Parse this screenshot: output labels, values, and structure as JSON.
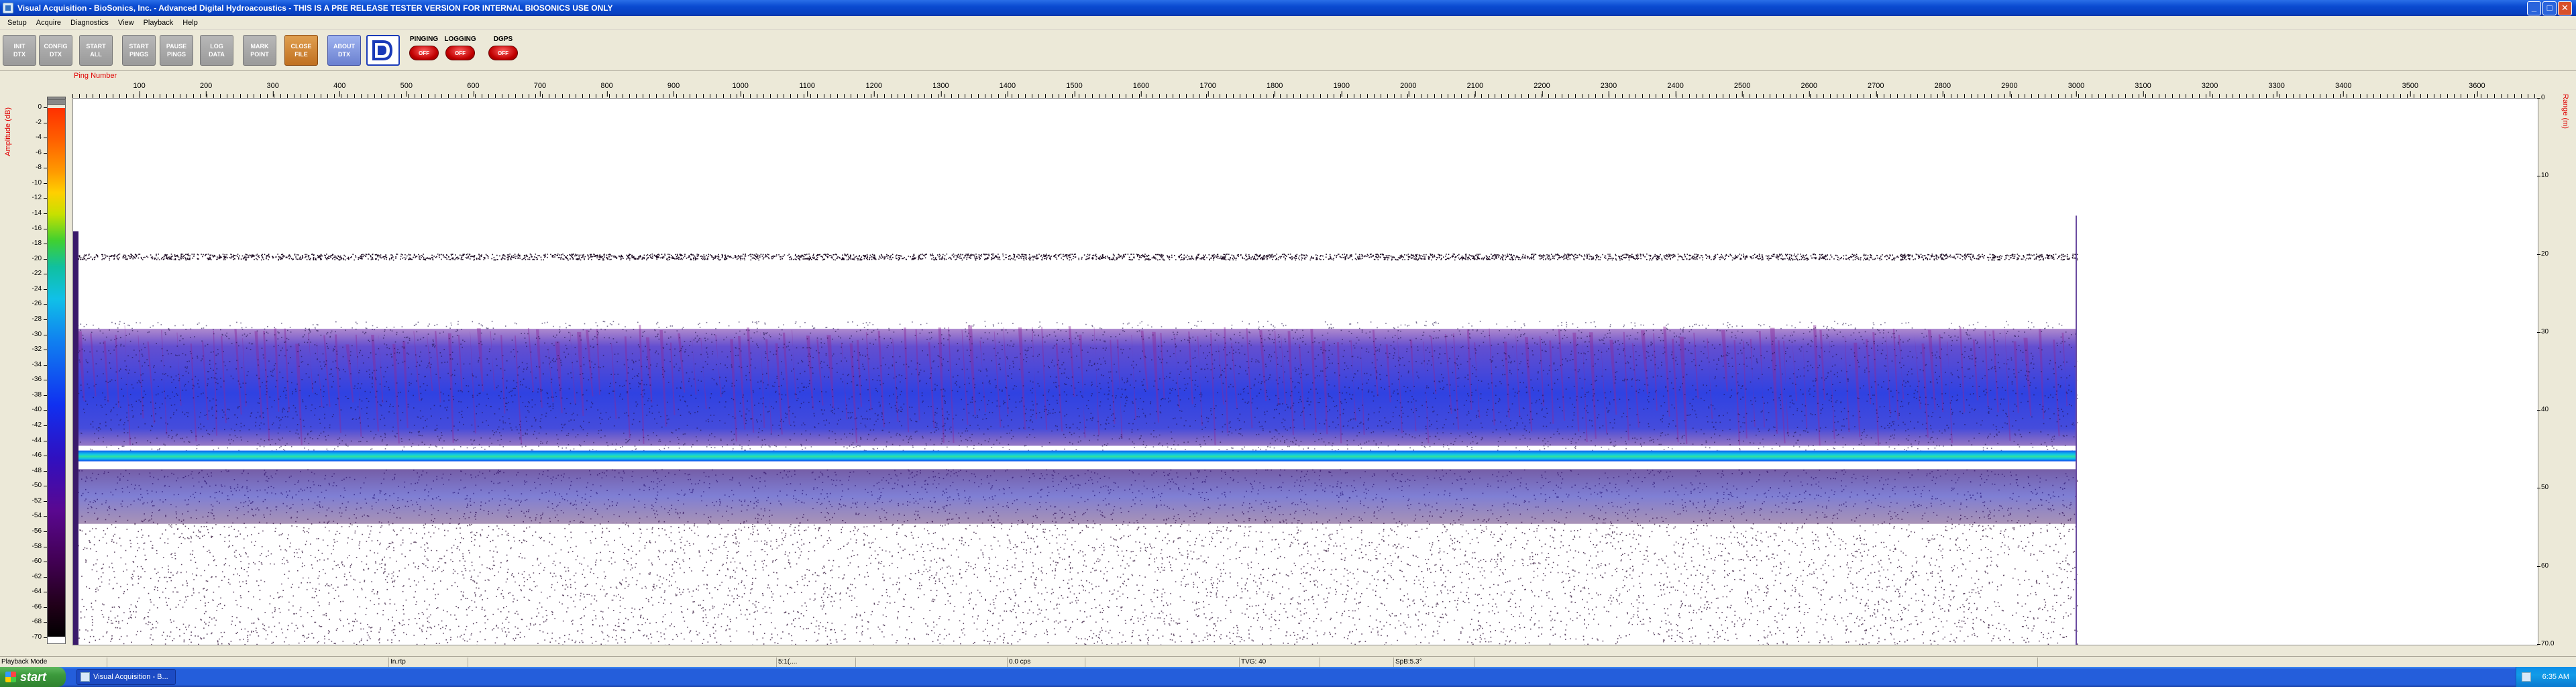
{
  "window": {
    "title": "Visual Acquisition  -  BioSonics, Inc.  -  Advanced Digital Hydroacoustics  -  THIS IS A PRE RELEASE TESTER VERSION FOR INTERNAL BIOSONICS USE ONLY",
    "min_label": "_",
    "max_label": "□",
    "close_label": "✕"
  },
  "menu": [
    "Setup",
    "Acquire",
    "Diagnostics",
    "View",
    "Playback",
    "Help"
  ],
  "toolbar": {
    "buttons": [
      {
        "line1": "INIT",
        "line2": "DTX",
        "style": "grey"
      },
      {
        "line1": "CONFIG",
        "line2": "DTX",
        "style": "grey"
      },
      {
        "line1": "START",
        "line2": "ALL",
        "style": "grey"
      },
      {
        "line1": "START",
        "line2": "PINGS",
        "style": "grey"
      },
      {
        "line1": "PAUSE",
        "line2": "PINGS",
        "style": "grey"
      },
      {
        "line1": "LOG",
        "line2": "DATA",
        "style": "grey"
      },
      {
        "line1": "MARK",
        "line2": "POINT",
        "style": "grey"
      },
      {
        "line1": "CLOSE",
        "line2": "FILE",
        "style": "orange"
      },
      {
        "line1": "ABOUT",
        "line2": "DTX",
        "style": "blue"
      }
    ],
    "indicators": [
      {
        "label": "PINGING",
        "state": "OFF"
      },
      {
        "label": "LOGGING",
        "state": "OFF"
      },
      {
        "label": "DGPS",
        "state": "OFF"
      }
    ]
  },
  "echogram": {
    "ping_axis_label": "Ping Number",
    "ping_ticks": [
      100,
      200,
      300,
      400,
      500,
      600,
      700,
      800,
      900,
      1000,
      1100,
      1200,
      1300,
      1400,
      1500,
      1600,
      1700,
      1800,
      1900,
      2000,
      2100,
      2200,
      2300,
      2400,
      2500,
      2600,
      2700,
      2800,
      2900,
      3000,
      3100,
      3200,
      3300,
      3400,
      3500,
      3600
    ],
    "ping_min": 0,
    "ping_max": 3690,
    "data_end_ping": 3000,
    "amplitude_axis_label": "Amplitude (dB)",
    "amplitude_ticks": [
      0,
      -2,
      -4,
      -6,
      -8,
      -10,
      -12,
      -14,
      -16,
      -18,
      -20,
      -22,
      -24,
      -26,
      -28,
      -30,
      -32,
      -34,
      -36,
      -38,
      -40,
      -42,
      -44,
      -46,
      -48,
      -50,
      -52,
      -54,
      -56,
      -58,
      -60,
      -62,
      -64,
      -66,
      -68,
      -70
    ],
    "range_axis_label": "Range (m)",
    "range_ticks": [
      "0",
      "10",
      "20",
      "30",
      "40",
      "50",
      "60",
      "70.0"
    ],
    "range_max": 70,
    "bands": {
      "surface_line_m": 20.2,
      "scatter_top_m": 29.5,
      "scatter_bottom_m": 44.5,
      "bottom_line_m": 45.8,
      "second_band_top_m": 47.5,
      "second_band_bottom_m": 54.5
    }
  },
  "status": {
    "mode": "Playback Mode",
    "cells": [
      "",
      "",
      "In.rtp",
      "",
      "5:1(....",
      "",
      "0.0 cps",
      "",
      "TVG: 40",
      "",
      "SpB:5.3°",
      "",
      ""
    ]
  },
  "taskbar": {
    "start_label": "start",
    "task_label": "Visual Acquisition - B...",
    "clock": "6:35 AM"
  }
}
